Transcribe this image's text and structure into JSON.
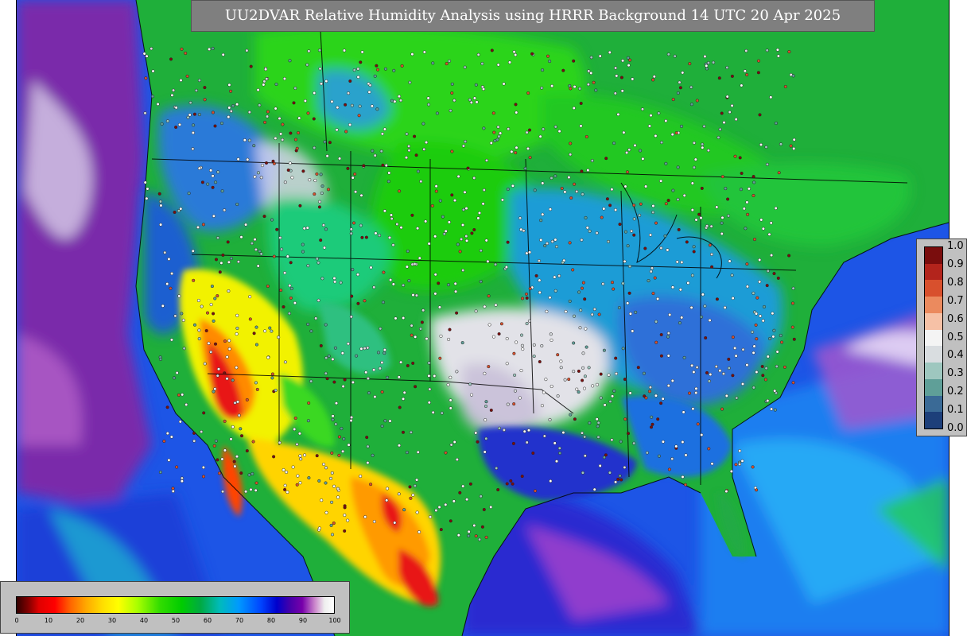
{
  "title": "UU2DVAR Relative Humidity Analysis using HRRR Background 14 UTC 20 Apr 2025",
  "colors": {
    "background_frame": "#ffffff",
    "banner": "#7f7f7f",
    "legend_panel": "#c0c0c0",
    "ocean_blue": "#1a4fe0",
    "ocean_purple": "#7a22a8",
    "land_green": "#22c40c",
    "land_teal": "#19a0b8",
    "dry_red": "#e81010",
    "dry_yellow": "#f5e300",
    "saturated_white": "#e8e8e8"
  },
  "colorbar_ratio": {
    "labels": [
      "1.0",
      "0.9",
      "0.8",
      "0.7",
      "0.6",
      "0.5",
      "0.4",
      "0.3",
      "0.2",
      "0.1",
      "0.0"
    ],
    "colors": [
      "#7a0d0d",
      "#b3241c",
      "#d8502d",
      "#eb8a5e",
      "#f6c1a6",
      "#f4f4f4",
      "#d9dde0",
      "#9ec7bf",
      "#5f9f98",
      "#3a6a96",
      "#1d3f7a"
    ]
  },
  "colorbar_rh": {
    "labels": [
      "0",
      "10",
      "20",
      "30",
      "40",
      "50",
      "60",
      "70",
      "80",
      "90",
      "100"
    ]
  }
}
